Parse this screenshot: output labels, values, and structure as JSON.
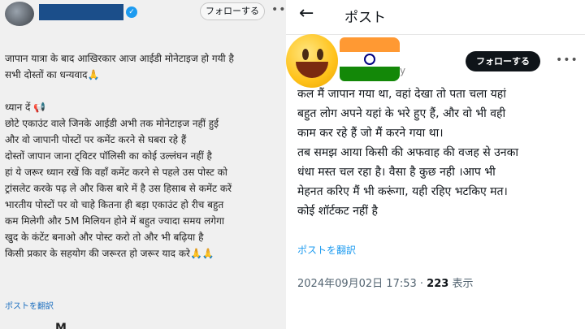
{
  "left_post": {
    "follow_label": "フォローする",
    "more_label": "•••",
    "verified_label": "✓",
    "lines": [
      "जापान यात्रा के बाद आखिरकार आज आईडी मोनेटाइज हो गयी है",
      "सभी दोस्तों का धन्यवाद🙏"
    ],
    "notice_lines": [
      "ध्यान दें 📢",
      "छोटे एकाउंट वाले जिनके आईडी अभी तक मोनेटाइज नहीं हुई",
      "और वो जापानी पोस्टों पर कमेंट करने से घबरा रहे हैं",
      "दोस्तों जापान जाना ट्विटर पॉलिसी का कोई उल्लंघन नहीं है",
      "हां ये जरूर ध्यान रखें कि वहाँ कमेंट करने से पहले उस पोस्ट को",
      "ट्रांसलेट करके पढ़ ले और किस बारे में है उस हिसाब से कमेंट करें",
      "भारतीय पोस्टों पर वो चाहे कितना ही बड़ा एकाउंट हो रीच बहुत",
      "कम मिलेगी और 5M मिलियन होने में बहुत ज्यादा समय लगेगा",
      "खुद के कंटेंट बनाओ और पोस्ट करो तो और भी बढ़िया है",
      "किसी प्रकार के सहयोग की जरूरत हो जरूर याद करे🙏🙏"
    ],
    "translate_label": "ポストを翻訳",
    "cutoff_text": "M..."
  },
  "right_post": {
    "back_icon": "←",
    "header_title": "ポスト",
    "handle_tail": "y",
    "follow_label": "フォローする",
    "more_label": "•••",
    "lines": [
      "कल मैं जापान गया था,  वहां देखा तो पता चला यहां",
      "बहुत लोग अपने यहां के भरे हुए हैं, और वो भी वही",
      "काम कर रहे हैं जो मैं करने गया था।",
      "तब समझ आया किसी की अफवाह की वजह से उनका",
      "धंधा मस्त चल रहा है। वैसा है कुछ नही ।आप भी",
      "मेहनत करिए मैं भी करूंगा, यही रहिए भटकिए मत।",
      "कोई शॉर्टकट नहीं है"
    ],
    "translate_label": "ポストを翻訳",
    "timestamp": "2024年09月02日 17:53 · ",
    "views_count": "223",
    "views_suffix": " 表示"
  },
  "colors": {
    "link_blue": "#1d9bf0",
    "follow_dark": "#0f1419",
    "left_bg": "#f0f0f0"
  }
}
